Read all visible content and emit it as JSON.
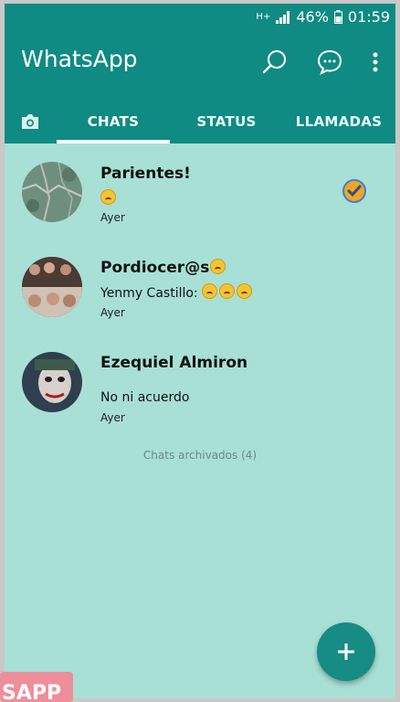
{
  "status_bar": {
    "battery": "46%",
    "time": "01:59",
    "network": "H+"
  },
  "app": {
    "title": "WhatsApp"
  },
  "tabs": [
    {
      "label": "CHATS"
    },
    {
      "label": "STATUS"
    },
    {
      "label": "LLAMADAS"
    }
  ],
  "chats": [
    {
      "name": "Parientes!",
      "message": "",
      "time": "Ayer"
    },
    {
      "name": "Pordiocer@s",
      "sender": "Yenmy Castillo:",
      "time": "Ayer"
    },
    {
      "name": "Ezequiel Almiron",
      "message": "No ni acuerdo",
      "time": "Ayer"
    }
  ],
  "archived": "Chats archivados (4)",
  "watermark": "SAPP",
  "colors": {
    "appbar": "#0f8b83",
    "background": "#a8e0d6",
    "fab": "#168c84"
  },
  "icons": {
    "search": "search-icon",
    "new_chat": "message-bubble-icon",
    "menu": "more-vert-icon",
    "camera": "camera-icon",
    "fab": "plus-icon"
  }
}
